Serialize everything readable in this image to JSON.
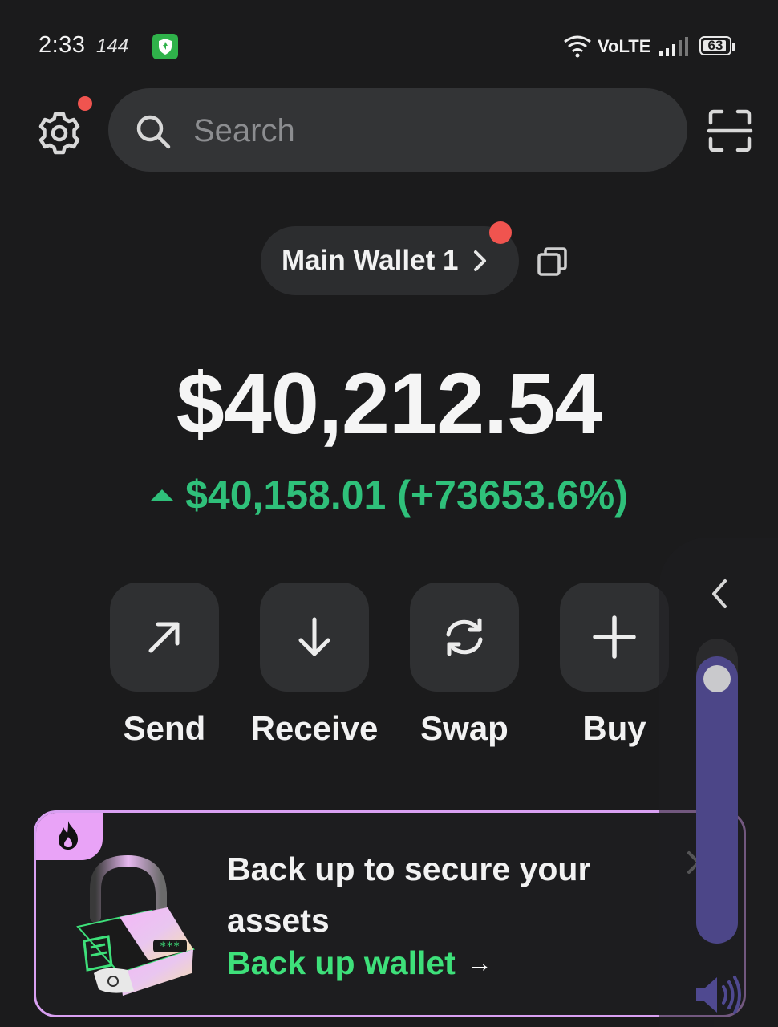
{
  "status_bar": {
    "time": "2:33",
    "refresh_rate": "144",
    "network": "VoLTE",
    "battery": "63"
  },
  "header": {
    "search_placeholder": "Search",
    "notification_color": "#f0544f"
  },
  "wallet": {
    "name": "Main Wallet 1"
  },
  "balance": {
    "total": "$40,212.54",
    "change": "$40,158.01 (+73653.6%)",
    "change_color": "#2fc07a"
  },
  "actions": [
    {
      "label": "Send",
      "icon": "arrow-up-right-icon"
    },
    {
      "label": "Receive",
      "icon": "arrow-down-icon"
    },
    {
      "label": "Swap",
      "icon": "swap-icon"
    },
    {
      "label": "Buy",
      "icon": "plus-icon"
    }
  ],
  "volume_panel": {
    "level": 0.97,
    "accent": "#4f4990"
  },
  "banner": {
    "text": "Back up to secure your assets",
    "link": "Back up wallet",
    "link_arrow": "→",
    "border_color": "#d9a0f2",
    "link_color": "#3ee07a"
  }
}
